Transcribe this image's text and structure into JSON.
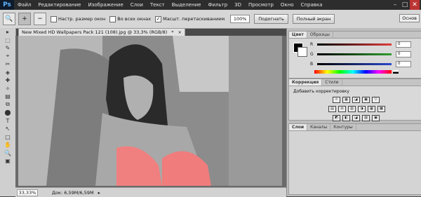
{
  "app": {
    "logo": "Ps"
  },
  "menu": [
    "Файл",
    "Редактирование",
    "Изображение",
    "Слои",
    "Текст",
    "Выделение",
    "Фильтр",
    "3D",
    "Просмотр",
    "Окно",
    "Справка"
  ],
  "window_buttons": [
    "–",
    "□",
    "✕"
  ],
  "options": {
    "resize_windows": "Настр. размер окон",
    "all_windows": "Во всех окнах",
    "scrubby_zoom": "Масшт. перетаскиванием",
    "zoom_value": "100%",
    "fit_button": "Подогнать",
    "fullscreen_button": "Полный экран",
    "workspace": "Основ"
  },
  "document": {
    "tab_title": "New Mixed HD Wallpapers Pack 121 (108).jpg @ 33,3% (RGB/8)",
    "tab_modified": "*",
    "tab_close": "×"
  },
  "status": {
    "zoom": "33,33%",
    "doc_size": "Док: 6,59M/6,59M",
    "arrow": "▸"
  },
  "color_panel": {
    "tabs": [
      "Цвет",
      "Образцы"
    ],
    "channels": [
      {
        "label": "R",
        "value": "0",
        "color": "#e23b3b"
      },
      {
        "label": "G",
        "value": "0",
        "color": "#2f9e2f"
      },
      {
        "label": "B",
        "value": "0",
        "color": "#2b48cc"
      }
    ]
  },
  "adjust_panel": {
    "tabs": [
      "Коррекция",
      "Стили"
    ],
    "title": "Добавить корректировку",
    "row1": [
      "☼",
      "▦",
      "◪",
      "▣",
      "▽"
    ],
    "row2": [
      "▤",
      "⚖",
      "▥",
      "◑",
      "▦",
      "▩"
    ],
    "row3": [
      "◩",
      "◧",
      "◪",
      "▨",
      "▣"
    ]
  },
  "layers_panel": {
    "tabs": [
      "Слои",
      "Каналы",
      "Контуры"
    ]
  },
  "tools": [
    "▸",
    "⬚",
    "✎",
    "⌖",
    "✂",
    "◈",
    "✚",
    "✧",
    "▤",
    "⧉",
    "⬤",
    "T",
    "↖",
    "□",
    "✋",
    "🔍",
    "▣"
  ],
  "colors": {
    "menu_bg": "#2d2d2d",
    "panel_bg": "#d9d9d9",
    "accent_ps": "#5fb3ff",
    "garment": "#f08080"
  }
}
